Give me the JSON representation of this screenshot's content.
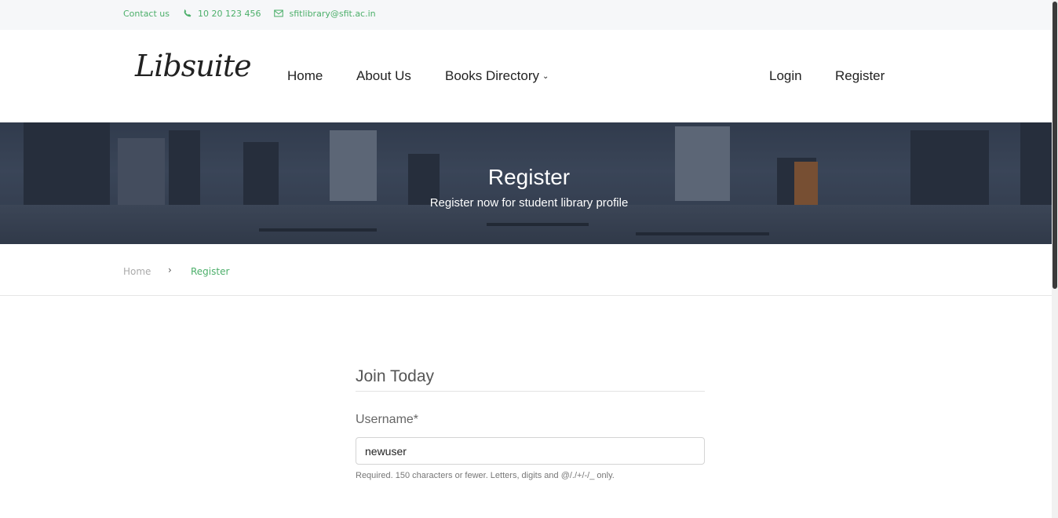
{
  "topbar": {
    "contact_label": "Contact us",
    "phone": "10 20 123 456",
    "email": "sfitlibrary@sfit.ac.in",
    "phone_icon": "phone-icon",
    "email_icon": "mail-icon",
    "accent_color": "#4caf6a"
  },
  "navbar": {
    "logo_text": "Libsuite",
    "links": [
      {
        "label": "Home"
      },
      {
        "label": "About Us"
      },
      {
        "label": "Books Directory"
      },
      {
        "label": "Login"
      },
      {
        "label": "Register"
      }
    ],
    "dropdown_icon": "chevron-down-icon"
  },
  "hero": {
    "title": "Register",
    "subtitle": "Register now for student library profile"
  },
  "breadcrumb": {
    "home": "Home",
    "separator": "›",
    "current": "Register"
  },
  "form": {
    "title": "Join Today",
    "username_label": "Username*",
    "username_value": "newuser",
    "username_help": "Required. 150 characters or fewer. Letters, digits and @/./+/-/_ only."
  }
}
